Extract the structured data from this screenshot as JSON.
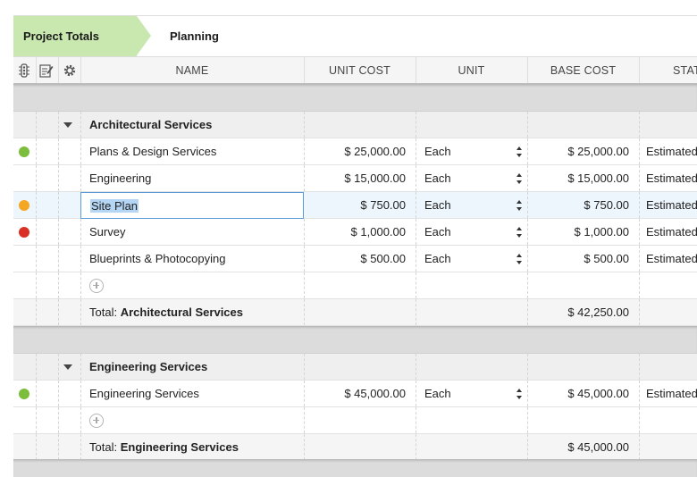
{
  "tabs": {
    "active": "Project Totals",
    "second": "Planning"
  },
  "columns": {
    "name": "NAME",
    "unit_cost": "UNIT COST",
    "unit": "UNIT",
    "base_cost": "BASE COST",
    "status": "STATUS"
  },
  "icons": {
    "col1": "traffic-light-icon",
    "col2": "note-edit-icon",
    "col3": "gear-icon"
  },
  "groups": [
    {
      "title": "Architectural Services",
      "items": [
        {
          "status_color": "#7cbd3c",
          "name": "Plans & Design Services",
          "unit_cost": "$ 25,000.00",
          "unit": "Each",
          "base_cost": "$ 25,000.00",
          "status": "Estimated"
        },
        {
          "status_color": "",
          "name": "Engineering",
          "unit_cost": "$ 15,000.00",
          "unit": "Each",
          "base_cost": "$ 15,000.00",
          "status": "Estimated"
        },
        {
          "status_color": "#f5a623",
          "name": "Site Plan",
          "unit_cost": "$ 750.00",
          "unit": "Each",
          "base_cost": "$ 750.00",
          "status": "Estimated"
        },
        {
          "status_color": "#d93025",
          "name": "Survey",
          "unit_cost": "$ 1,000.00",
          "unit": "Each",
          "base_cost": "$ 1,000.00",
          "status": "Estimated"
        },
        {
          "status_color": "",
          "name": "Blueprints & Photocopying",
          "unit_cost": "$ 500.00",
          "unit": "Each",
          "base_cost": "$ 500.00",
          "status": "Estimated"
        }
      ],
      "total_label": "Total:",
      "total_name": "Architectural Services",
      "total_value": "$ 42,250.00"
    },
    {
      "title": "Engineering Services",
      "items": [
        {
          "status_color": "#7cbd3c",
          "name": "Engineering Services",
          "unit_cost": "$ 45,000.00",
          "unit": "Each",
          "base_cost": "$ 45,000.00",
          "status": "Estimated"
        }
      ],
      "total_label": "Total:",
      "total_name": "Engineering Services",
      "total_value": "$ 45,000.00"
    }
  ]
}
